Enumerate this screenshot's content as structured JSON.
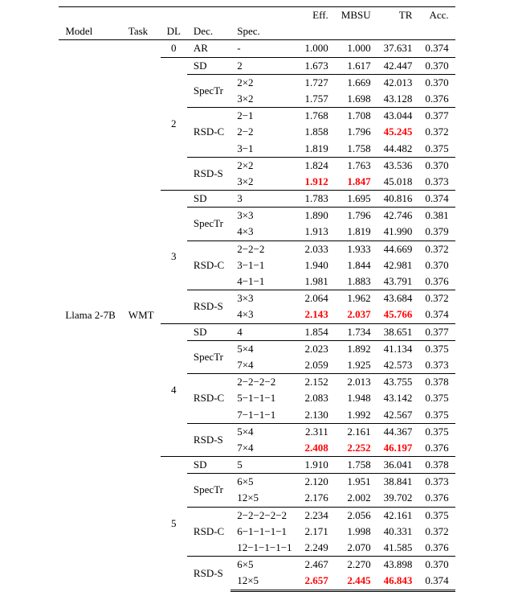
{
  "headers": {
    "model": "Model",
    "task": "Task",
    "dl": "DL",
    "dec": "Dec.",
    "spec": "Spec.",
    "eff": "Eff.",
    "mbsu": "MBSU",
    "tr": "TR",
    "acc": "Acc."
  },
  "model": "Llama 2-7B",
  "task": "WMT",
  "chart_data": {
    "type": "table",
    "columns": [
      "Model",
      "Task",
      "DL",
      "Dec.",
      "Spec.",
      "Eff.",
      "MBSU",
      "TR",
      "Acc."
    ],
    "groups": [
      {
        "dl": "0",
        "blocks": [
          {
            "dec": "AR",
            "rows": [
              {
                "spec": "-",
                "eff": "1.000",
                "mbsu": "1.000",
                "tr": "37.631",
                "acc": "0.374"
              }
            ]
          }
        ]
      },
      {
        "dl": "2",
        "blocks": [
          {
            "dec": "SD",
            "rows": [
              {
                "spec": "2",
                "eff": "1.673",
                "mbsu": "1.617",
                "tr": "42.447",
                "acc": "0.370"
              }
            ]
          },
          {
            "dec": "SpecTr",
            "rows": [
              {
                "spec": "2×2",
                "eff": "1.727",
                "mbsu": "1.669",
                "tr": "42.013",
                "acc": "0.370"
              },
              {
                "spec": "3×2",
                "eff": "1.757",
                "mbsu": "1.698",
                "tr": "43.128",
                "acc": "0.376"
              }
            ]
          },
          {
            "dec": "RSD-C",
            "rows": [
              {
                "spec": "2−1",
                "eff": "1.768",
                "mbsu": "1.708",
                "tr": "43.044",
                "acc": "0.377"
              },
              {
                "spec": "2−2",
                "eff": "1.858",
                "mbsu": "1.796",
                "tr": "45.245",
                "acc": "0.372",
                "hl": [
                  "tr"
                ]
              },
              {
                "spec": "3−1",
                "eff": "1.819",
                "mbsu": "1.758",
                "tr": "44.482",
                "acc": "0.375"
              }
            ]
          },
          {
            "dec": "RSD-S",
            "rows": [
              {
                "spec": "2×2",
                "eff": "1.824",
                "mbsu": "1.763",
                "tr": "43.536",
                "acc": "0.370"
              },
              {
                "spec": "3×2",
                "eff": "1.912",
                "mbsu": "1.847",
                "tr": "45.018",
                "acc": "0.373",
                "hl": [
                  "eff",
                  "mbsu"
                ]
              }
            ]
          }
        ]
      },
      {
        "dl": "3",
        "blocks": [
          {
            "dec": "SD",
            "rows": [
              {
                "spec": "3",
                "eff": "1.783",
                "mbsu": "1.695",
                "tr": "40.816",
                "acc": "0.374"
              }
            ]
          },
          {
            "dec": "SpecTr",
            "rows": [
              {
                "spec": "3×3",
                "eff": "1.890",
                "mbsu": "1.796",
                "tr": "42.746",
                "acc": "0.381"
              },
              {
                "spec": "4×3",
                "eff": "1.913",
                "mbsu": "1.819",
                "tr": "41.990",
                "acc": "0.379"
              }
            ]
          },
          {
            "dec": "RSD-C",
            "rows": [
              {
                "spec": "2−2−2",
                "eff": "2.033",
                "mbsu": "1.933",
                "tr": "44.669",
                "acc": "0.372"
              },
              {
                "spec": "3−1−1",
                "eff": "1.940",
                "mbsu": "1.844",
                "tr": "42.981",
                "acc": "0.370"
              },
              {
                "spec": "4−1−1",
                "eff": "1.981",
                "mbsu": "1.883",
                "tr": "43.791",
                "acc": "0.376"
              }
            ]
          },
          {
            "dec": "RSD-S",
            "rows": [
              {
                "spec": "3×3",
                "eff": "2.064",
                "mbsu": "1.962",
                "tr": "43.684",
                "acc": "0.372"
              },
              {
                "spec": "4×3",
                "eff": "2.143",
                "mbsu": "2.037",
                "tr": "45.766",
                "acc": "0.374",
                "hl": [
                  "eff",
                  "mbsu",
                  "tr"
                ]
              }
            ]
          }
        ]
      },
      {
        "dl": "4",
        "blocks": [
          {
            "dec": "SD",
            "rows": [
              {
                "spec": "4",
                "eff": "1.854",
                "mbsu": "1.734",
                "tr": "38.651",
                "acc": "0.377"
              }
            ]
          },
          {
            "dec": "SpecTr",
            "rows": [
              {
                "spec": "5×4",
                "eff": "2.023",
                "mbsu": "1.892",
                "tr": "41.134",
                "acc": "0.375"
              },
              {
                "spec": "7×4",
                "eff": "2.059",
                "mbsu": "1.925",
                "tr": "42.573",
                "acc": "0.373"
              }
            ]
          },
          {
            "dec": "RSD-C",
            "rows": [
              {
                "spec": "2−2−2−2",
                "eff": "2.152",
                "mbsu": "2.013",
                "tr": "43.755",
                "acc": "0.378"
              },
              {
                "spec": "5−1−1−1",
                "eff": "2.083",
                "mbsu": "1.948",
                "tr": "43.142",
                "acc": "0.375"
              },
              {
                "spec": "7−1−1−1",
                "eff": "2.130",
                "mbsu": "1.992",
                "tr": "42.567",
                "acc": "0.375"
              }
            ]
          },
          {
            "dec": "RSD-S",
            "rows": [
              {
                "spec": "5×4",
                "eff": "2.311",
                "mbsu": "2.161",
                "tr": "44.367",
                "acc": "0.375"
              },
              {
                "spec": "7×4",
                "eff": "2.408",
                "mbsu": "2.252",
                "tr": "46.197",
                "acc": "0.376",
                "hl": [
                  "eff",
                  "mbsu",
                  "tr"
                ]
              }
            ]
          }
        ]
      },
      {
        "dl": "5",
        "blocks": [
          {
            "dec": "SD",
            "rows": [
              {
                "spec": "5",
                "eff": "1.910",
                "mbsu": "1.758",
                "tr": "36.041",
                "acc": "0.378"
              }
            ]
          },
          {
            "dec": "SpecTr",
            "rows": [
              {
                "spec": "6×5",
                "eff": "2.120",
                "mbsu": "1.951",
                "tr": "38.841",
                "acc": "0.373"
              },
              {
                "spec": "12×5",
                "eff": "2.176",
                "mbsu": "2.002",
                "tr": "39.702",
                "acc": "0.376"
              }
            ]
          },
          {
            "dec": "RSD-C",
            "rows": [
              {
                "spec": "2−2−2−2−2",
                "eff": "2.234",
                "mbsu": "2.056",
                "tr": "42.161",
                "acc": "0.375"
              },
              {
                "spec": "6−1−1−1−1",
                "eff": "2.171",
                "mbsu": "1.998",
                "tr": "40.331",
                "acc": "0.372"
              },
              {
                "spec": "12−1−1−1−1",
                "eff": "2.249",
                "mbsu": "2.070",
                "tr": "41.585",
                "acc": "0.376"
              }
            ]
          },
          {
            "dec": "RSD-S",
            "rows": [
              {
                "spec": "6×5",
                "eff": "2.467",
                "mbsu": "2.270",
                "tr": "43.898",
                "acc": "0.370"
              },
              {
                "spec": "12×5",
                "eff": "2.657",
                "mbsu": "2.445",
                "tr": "46.843",
                "acc": "0.374",
                "hl": [
                  "eff",
                  "mbsu",
                  "tr"
                ]
              }
            ]
          }
        ]
      }
    ]
  }
}
